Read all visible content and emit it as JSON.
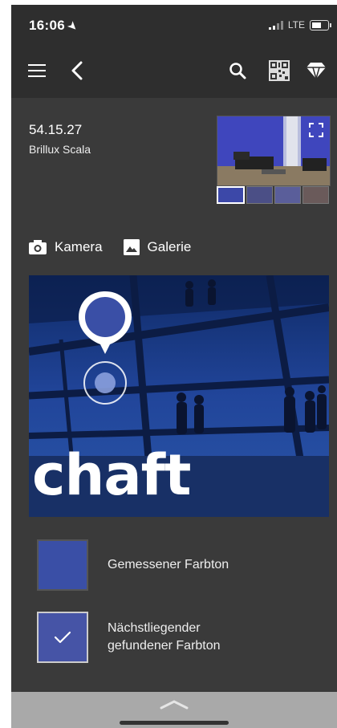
{
  "status": {
    "time": "16:06",
    "network": "LTE"
  },
  "toolbar": {
    "menu_icon": "hamburger-icon",
    "back_icon": "chevron-left-icon",
    "search_icon": "search-icon",
    "qr_icon": "qr-code-icon",
    "diamond_icon": "diamond-icon"
  },
  "color": {
    "code": "54.15.27",
    "brand": "Brillux Scala"
  },
  "actions": {
    "camera": "Kamera",
    "gallery": "Galerie"
  },
  "photo": {
    "overlay_text": "chaft"
  },
  "swatches": {
    "measured_label": "Gemessener Farbton",
    "nearest_label_line1": "Nächstliegender",
    "nearest_label_line2": "gefundener Farbton",
    "measured_color": "#3a4fa6",
    "nearest_color": "#4654a6"
  },
  "colors": {
    "background": "#3a3a3a",
    "bar": "#2e2e2e",
    "bottom_panel": "#a9a9a9"
  }
}
